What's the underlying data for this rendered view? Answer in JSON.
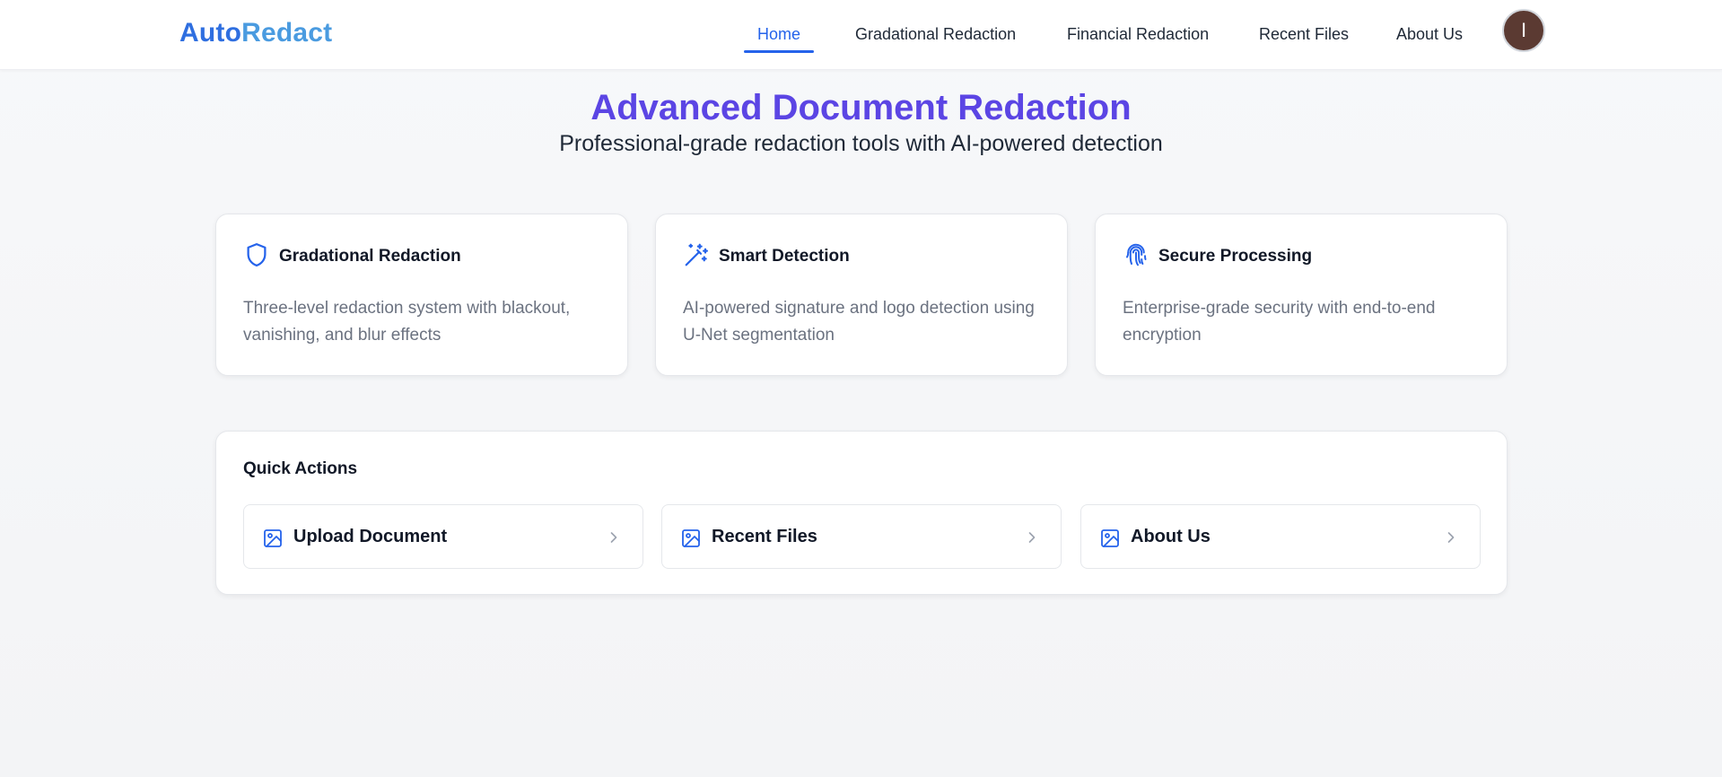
{
  "navbar": {
    "brand_part1": "Auto",
    "brand_part2": "Redact",
    "items": [
      {
        "label": "Home",
        "active": true
      },
      {
        "label": "Gradational Redaction",
        "active": false
      },
      {
        "label": "Financial Redaction",
        "active": false
      },
      {
        "label": "Recent Files",
        "active": false
      },
      {
        "label": "About Us",
        "active": false
      }
    ],
    "avatar_initial": "I"
  },
  "hero": {
    "title": "Advanced Document Redaction",
    "subtitle": "Professional-grade redaction tools with AI-powered detection"
  },
  "features": [
    {
      "icon": "shield-icon",
      "title": "Gradational Redaction",
      "description": "Three-level redaction system with blackout, vanishing, and blur effects"
    },
    {
      "icon": "magic-wand-icon",
      "title": "Smart Detection",
      "description": "AI-powered signature and logo detection using U-Net segmentation"
    },
    {
      "icon": "fingerprint-icon",
      "title": "Secure Processing",
      "description": "Enterprise-grade security with end-to-end encryption"
    }
  ],
  "quick_actions": {
    "title": "Quick Actions",
    "items": [
      {
        "icon": "image-icon",
        "label": "Upload Document"
      },
      {
        "icon": "image-icon",
        "label": "Recent Files"
      },
      {
        "icon": "image-icon",
        "label": "About Us"
      }
    ]
  },
  "colors": {
    "accent": "#2563eb",
    "hero_title": "#5b45e4",
    "avatar_bg": "#5b3a32"
  }
}
